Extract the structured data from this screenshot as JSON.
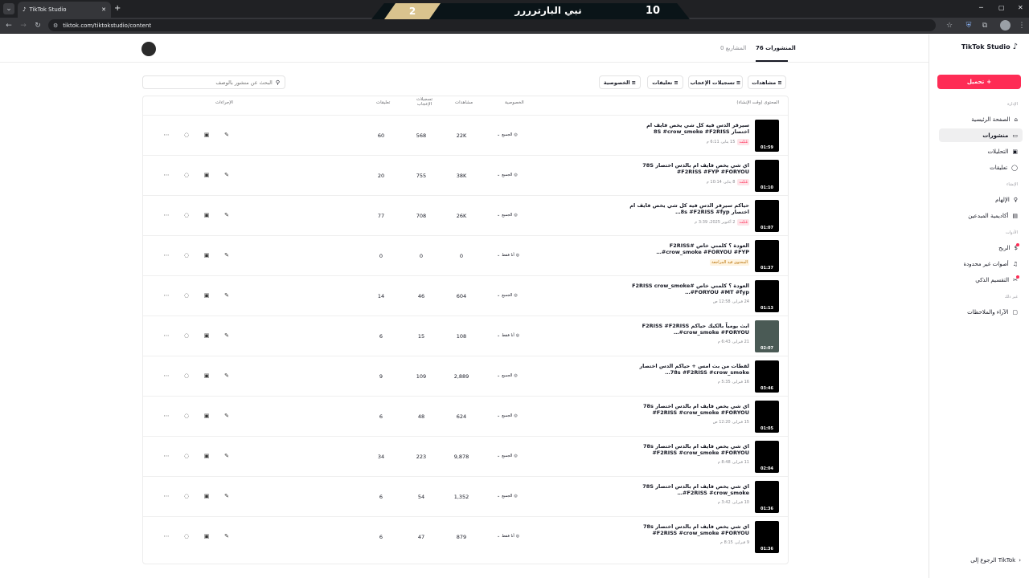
{
  "browser": {
    "tab_title": "TikTok Studio",
    "new_tab": "+",
    "url": "tiktok.com/tiktokstudio/content"
  },
  "score_overlay": {
    "left_score": "2",
    "title": "نبي البارترررر",
    "right_score": "10"
  },
  "sidebar": {
    "logo": "TikTok Studio",
    "upload_label": "تحميل",
    "section_manage": "الإدارة",
    "section_tools": "الأدوات",
    "section_create": "الإنشاء",
    "section_other": "غير ذلك",
    "items": [
      {
        "label": "الصفحة الرئيسية",
        "icon": "home-icon"
      },
      {
        "label": "منشورات",
        "icon": "folder-icon",
        "active": true
      },
      {
        "label": "التحليلات",
        "icon": "chart-icon"
      },
      {
        "label": "تعليقات",
        "icon": "comment-icon"
      },
      {
        "label": "الإلهام",
        "icon": "lightbulb-icon"
      },
      {
        "label": "أكاديمية المبدعين",
        "icon": "academy-icon"
      },
      {
        "label": "الربح",
        "icon": "money-icon"
      },
      {
        "label": "أصوات غير محدودة",
        "icon": "music-icon"
      },
      {
        "label": "التقسيم الذكي",
        "icon": "scissors-icon"
      },
      {
        "label": "الآراء والملاحظات",
        "icon": "feedback-icon"
      }
    ],
    "back_label": "الرجوع إلى TikTok"
  },
  "header": {
    "tabs": [
      {
        "label": "المنشورات 76",
        "active": true
      },
      {
        "label": "المشاريع 0"
      }
    ]
  },
  "filters": {
    "search_placeholder": "البحث عن منشور بالوصف",
    "buttons": [
      "مشاهدات",
      "تسجيلات الإعجاب",
      "تعليقات",
      "الخصوصية"
    ]
  },
  "table": {
    "headers": {
      "content": "المحتوى (وقت الإنشاء)",
      "privacy": "الخصوصية",
      "views": "مشاهدات",
      "likes": "تسجيلات الإعجاب",
      "comments": "تعليقات",
      "actions": "الإجراءات"
    },
    "rows": [
      {
        "title": "سيرقر الدس فيه كل شي يخص فايف ام اختصار 8S #crow_smoke #F2RISS",
        "date": "15 يناير، 6:11 م",
        "badge": "مُثبّت",
        "duration": "01:59",
        "privacy": "الجميع",
        "views": "22K",
        "likes": "568",
        "comments": "60"
      },
      {
        "title": "اي شي يخص فايف ام بالدس اختصار 78S #F2RISS #FYP #FORYOU",
        "date": "8 يناير، 10:14 م",
        "badge": "مُثبّت",
        "duration": "01:10",
        "privacy": "الجميع",
        "views": "38K",
        "likes": "755",
        "comments": "20"
      },
      {
        "title": "حياكم سيرقر الدس فيه كل شي يخص فايف ام اختصار 8s #F2RISS #fyp…",
        "date": "2 أكتوبر 2025، 3:39 م",
        "badge": "مُثبّت",
        "duration": "01:07",
        "privacy": "الجميع",
        "views": "26K",
        "likes": "708",
        "comments": "77"
      },
      {
        "title": "العودة ؟ كلمني خاص #F2RISS #crow_smoke #FORYOU #FYP…",
        "date": "",
        "badge": "المحتوى قيد المراجعة",
        "badge_warn": true,
        "duration": "01:37",
        "privacy": "أنا فقط",
        "views": "0",
        "likes": "0",
        "comments": "0"
      },
      {
        "title": "العودة ؟ كلمني خاص #F2RISS crow_smoke #FORYOU #MT #fyp…",
        "date": "24 فبراير، 12:58 ص",
        "badge": "",
        "duration": "01:13",
        "privacy": "الجميع",
        "views": "604",
        "likes": "46",
        "comments": "14"
      },
      {
        "title": "ابث يومياً بالكيك حياكم F2RISS #F2RISS #crow_smoke #FORYOU…",
        "date": "21 فبراير، 6:43 م",
        "badge": "",
        "duration": "02:07",
        "privacy": "أنا فقط",
        "views": "108",
        "likes": "15",
        "comments": "6",
        "thumb_color": "#4a5a55"
      },
      {
        "title": "لقطات من بث امس + حياكم الدس اختصار 78s #F2RISS #crow_smoke…",
        "date": "16 فبراير، 5:35 م",
        "badge": "",
        "duration": "03:46",
        "privacy": "الجميع",
        "views": "2,889",
        "likes": "109",
        "comments": "9"
      },
      {
        "title": "اي شي يخص فايف ام بالدس اختصار 78s #F2RISS #crow_smoke #FORYOU",
        "date": "15 فبراير، 12:20 ص",
        "badge": "",
        "duration": "01:05",
        "privacy": "الجميع",
        "views": "624",
        "likes": "48",
        "comments": "6"
      },
      {
        "title": "اي شي يخص فايف ام بالدس اختصار 78s #F2RISS #crow_smoke #FORYOU",
        "date": "11 فبراير، 8:48 م",
        "badge": "",
        "duration": "02:04",
        "privacy": "الجميع",
        "views": "9,878",
        "likes": "223",
        "comments": "34"
      },
      {
        "title": "اي شي يخص فايف ام بالدس اختصار 78S #F2RISS #crow_smoke…",
        "date": "10 فبراير، 3:42 م",
        "badge": "",
        "duration": "01:36",
        "privacy": "الجميع",
        "views": "1,352",
        "likes": "54",
        "comments": "6"
      },
      {
        "title": "اي شي يخص فايف ام بالدس اختصار 78s #F2RISS #crow_smoke #FORYOU",
        "date": "9 فبراير، 8:15 م",
        "badge": "",
        "duration": "01:36",
        "privacy": "أنا فقط",
        "views": "879",
        "likes": "47",
        "comments": "6"
      }
    ]
  },
  "colors": {
    "accent": "#fe2c55",
    "text": "#161823"
  }
}
